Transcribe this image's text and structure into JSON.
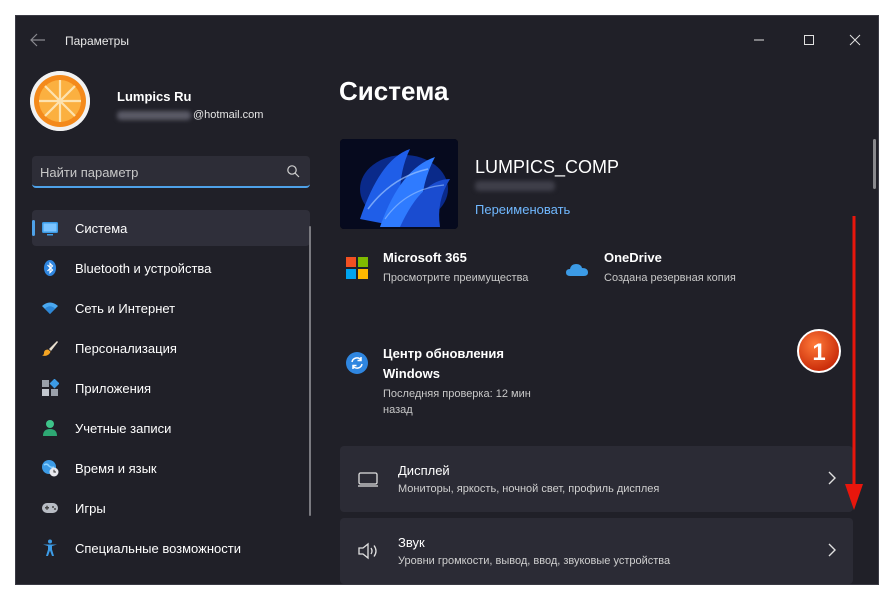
{
  "window": {
    "title": "Параметры"
  },
  "profile": {
    "name": "Lumpics Ru",
    "email_domain": "@hotmail.com"
  },
  "search": {
    "placeholder": "Найти параметр"
  },
  "sidebar": {
    "items": [
      {
        "label": "Система",
        "icon": "display-icon",
        "active": true
      },
      {
        "label": "Bluetooth и устройства",
        "icon": "bluetooth-icon",
        "active": false
      },
      {
        "label": "Сеть и Интернет",
        "icon": "wifi-icon",
        "active": false
      },
      {
        "label": "Персонализация",
        "icon": "brush-icon",
        "active": false
      },
      {
        "label": "Приложения",
        "icon": "apps-icon",
        "active": false
      },
      {
        "label": "Учетные записи",
        "icon": "person-icon",
        "active": false
      },
      {
        "label": "Время и язык",
        "icon": "globe-clock-icon",
        "active": false
      },
      {
        "label": "Игры",
        "icon": "gamepad-icon",
        "active": false
      },
      {
        "label": "Специальные возможности",
        "icon": "accessibility-icon",
        "active": false
      }
    ]
  },
  "main": {
    "title": "Система",
    "device": {
      "name": "LUMPICS_COMP",
      "rename_label": "Переименовать"
    },
    "tiles": [
      {
        "title": "Microsoft 365",
        "subtitle": "Просмотрите преимущества",
        "icon": "microsoft-logo-icon"
      },
      {
        "title": "OneDrive",
        "subtitle": "Создана резервная копия",
        "icon": "cloud-icon"
      },
      {
        "title_line1": "Центр обновления",
        "title_line2": "Windows",
        "subtitle_line1": "Последняя проверка: 12 мин",
        "subtitle_line2": "назад",
        "icon": "update-icon"
      }
    ],
    "cards": [
      {
        "title": "Дисплей",
        "subtitle": "Мониторы, яркость, ночной свет, профиль дисплея",
        "icon": "monitor-icon"
      },
      {
        "title": "Звук",
        "subtitle": "Уровни громкости, вывод, ввод, звуковые устройства",
        "icon": "speaker-icon"
      }
    ]
  },
  "annotation": {
    "badge_number": "1"
  },
  "colors": {
    "window_bg": "#202028",
    "accent": "#4ea1e8",
    "link": "#70b8ff",
    "card_bg": "#2b2b35",
    "annotation_red": "#e8160c"
  }
}
